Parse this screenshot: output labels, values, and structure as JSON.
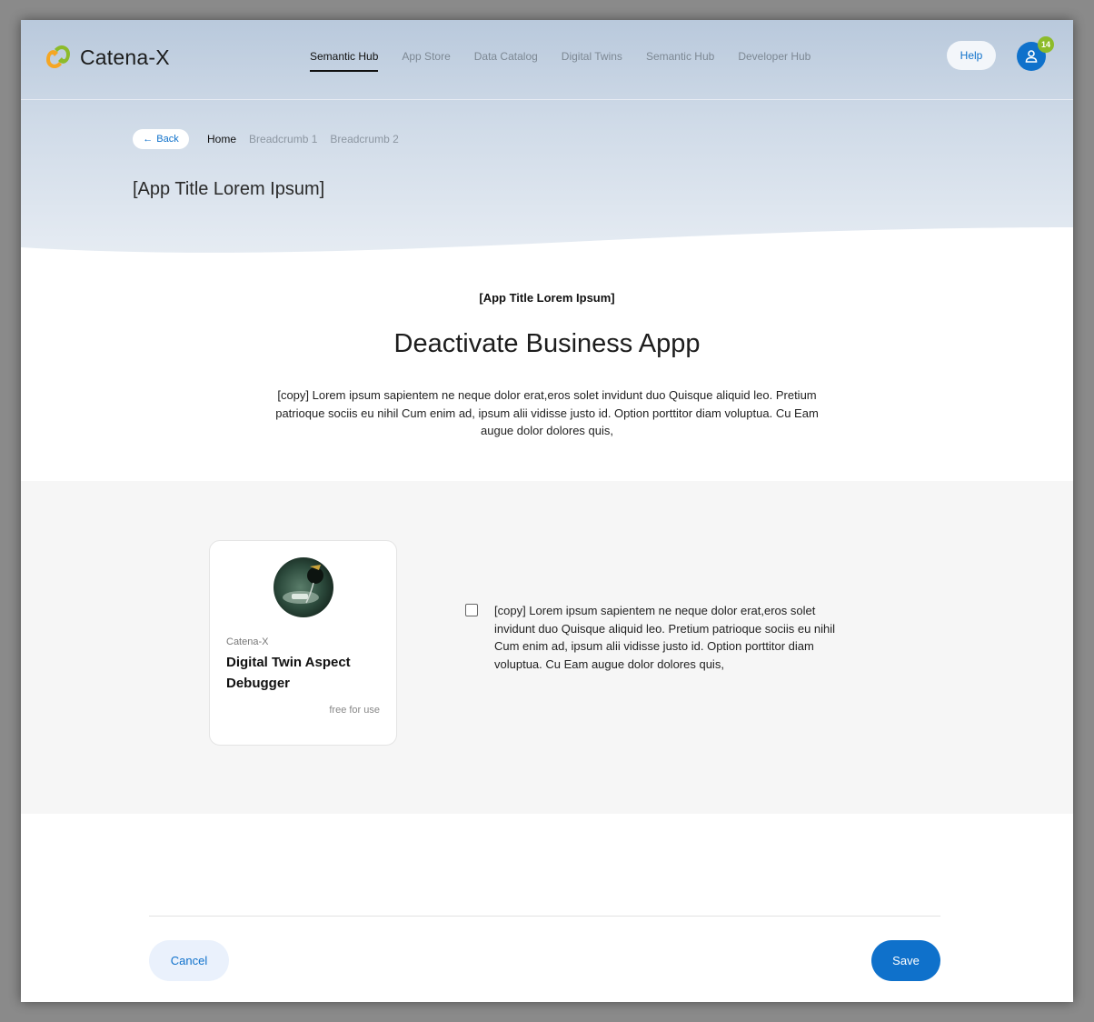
{
  "brand": {
    "name": "Catena-X",
    "logo_icon": "catena-x-logo-icon"
  },
  "nav": {
    "items": [
      {
        "label": "Semantic Hub",
        "active": true
      },
      {
        "label": "App Store",
        "active": false
      },
      {
        "label": "Data Catalog",
        "active": false
      },
      {
        "label": "Digital Twins",
        "active": false
      },
      {
        "label": "Semantic Hub",
        "active": false
      },
      {
        "label": "Developer Hub",
        "active": false
      }
    ]
  },
  "header": {
    "help_label": "Help",
    "user_icon": "user-icon",
    "notification_count": "14"
  },
  "hero": {
    "back_label": "Back",
    "breadcrumbs": [
      "Home",
      "Breadcrumb 1",
      "Breadcrumb 2"
    ],
    "title": "[App Title Lorem Ipsum]"
  },
  "main": {
    "kicker": "[App Title Lorem Ipsum]",
    "heading": "Deactivate Business Appp",
    "copy": "[copy] Lorem ipsum sapientem ne neque dolor erat,eros solet invidunt duo Quisque aliquid leo. Pretium patrioque sociis eu nihil Cum enim ad, ipsum alii vidisse justo id. Option porttitor diam voluptua. Cu Eam augue dolor dolores quis,"
  },
  "app_card": {
    "vendor": "Catena-X",
    "name": "Digital Twin Aspect Debugger",
    "price": "free for use"
  },
  "confirmation": {
    "checked": false,
    "text": "[copy] Lorem ipsum sapientem ne neque dolor erat,eros solet invidunt duo Quisque aliquid leo. Pretium patrioque sociis eu nihil Cum enim ad, ipsum alii vidisse justo id. Option porttitor diam voluptua. Cu Eam augue dolor dolores quis,"
  },
  "footer": {
    "cancel_label": "Cancel",
    "save_label": "Save"
  },
  "colors": {
    "primary": "#0f71cb",
    "badge": "#8dbb2a",
    "hero_top": "#b9c9dc",
    "band": "#f6f6f6"
  }
}
